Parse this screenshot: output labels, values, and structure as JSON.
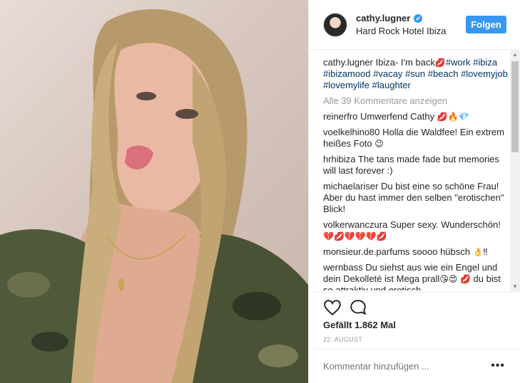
{
  "post": {
    "username": "cathy.lugner",
    "location": "Hard Rock Hotel Ibiza",
    "follow_label": "Folgen",
    "verified_icon": "✔",
    "caption": {
      "user": "cathy.lugner",
      "text": "Ibiza- I'm back",
      "emoji": "💋",
      "tags": [
        "#work",
        "#ibiza",
        "#ibizamood",
        "#vacay",
        "#sun",
        "#beach",
        "#lovemyjob",
        "#lovemylife",
        "#laughter"
      ]
    },
    "load_more": "Alle 39 Kommentare anzeigen",
    "comments": [
      {
        "user": "reinerfro",
        "text": "Umwerfend Cathy",
        "emoji": "💋🔥💎"
      },
      {
        "user": "voelkelhino80",
        "text": "Holla die Waldfee! Ein extrem heißes Foto",
        "emoji": "😉"
      },
      {
        "user": "hrhibiza",
        "text": "The tans made fade but memories will last forever :)",
        "emoji": ""
      },
      {
        "user": "michaelariser",
        "text": "Du bist eine so schöne Frau! Aber du hast immer den selben \"erotischen\" Blick!",
        "emoji": ""
      },
      {
        "user": "volkerwanczura",
        "text": "Super sexy. Wunderschön!",
        "emoji": "💔💋💔💔💔💋"
      },
      {
        "user": "monsieur.de.parfums",
        "text": "soooo hübsch",
        "emoji": "👌‼"
      },
      {
        "user": "wernbass",
        "text": "Du siehst aus wie ein Engel und dein Dekolleté ist Mega prall",
        "emoji": "😘😍"
      },
      {
        "user": "",
        "text": "du bist so attraktiv und erotisch",
        "emoji": "💋"
      }
    ],
    "likes": "Gefällt 1.862 Mal",
    "date": "22. AUGUST",
    "comment_placeholder": "Kommentar hinzufügen ...",
    "more_options": "•••",
    "scroll_up": "▲",
    "scroll_down": "▼"
  },
  "colors": {
    "accent": "#3897f0",
    "hashtag": "#003569",
    "muted": "#999999",
    "border": "#efefef"
  },
  "icons": [
    "heart-icon",
    "comment-icon",
    "verified-icon",
    "more-options-icon"
  ]
}
